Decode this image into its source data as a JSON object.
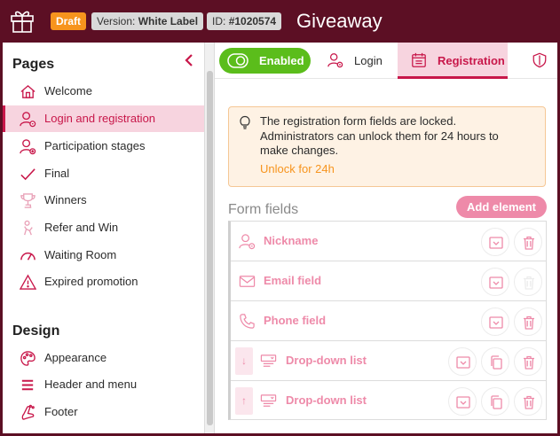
{
  "header": {
    "status_badge": "Draft",
    "version_label": "Version:",
    "version_value": "White Label",
    "id_label": "ID:",
    "id_value": "#1020574",
    "title": "Giveaway"
  },
  "sidebar": {
    "pages_heading": "Pages",
    "pages": [
      {
        "label": "Welcome",
        "icon": "home-icon"
      },
      {
        "label": "Login and registration",
        "icon": "user-lock-icon",
        "active": true
      },
      {
        "label": "Participation stages",
        "icon": "user-add-icon"
      },
      {
        "label": "Final",
        "icon": "check-icon"
      },
      {
        "label": "Winners",
        "icon": "trophy-icon"
      },
      {
        "label": "Refer and Win",
        "icon": "refer-icon"
      },
      {
        "label": "Waiting Room",
        "icon": "gauge-icon"
      },
      {
        "label": "Expired promotion",
        "icon": "warning-icon"
      }
    ],
    "design_heading": "Design",
    "design": [
      {
        "label": "Appearance",
        "icon": "palette-icon"
      },
      {
        "label": "Header and menu",
        "icon": "menu-icon"
      },
      {
        "label": "Footer",
        "icon": "footer-icon"
      }
    ]
  },
  "tabs": {
    "enabled_label": "Enabled",
    "login_label": "Login",
    "registration_label": "Registration"
  },
  "notice": {
    "text": "The registration form fields are locked. Administrators can unlock them for 24 hours to make changes.",
    "action": "Unlock for 24h"
  },
  "form": {
    "title": "Form fields",
    "add_button": "Add element",
    "fields": [
      {
        "label": "Nickname",
        "icon": "user-icon"
      },
      {
        "label": "Email field",
        "icon": "envelope-icon"
      },
      {
        "label": "Phone field",
        "icon": "phone-icon"
      },
      {
        "label": "Drop-down list",
        "icon": "dropdown-icon",
        "move": "↓"
      },
      {
        "label": "Drop-down list",
        "icon": "dropdown-icon",
        "move": "↑"
      }
    ]
  },
  "colors": {
    "brand": "#5c0f24",
    "accent": "#c8174a",
    "enabled": "#5bbd1b",
    "draft": "#f7941d"
  }
}
